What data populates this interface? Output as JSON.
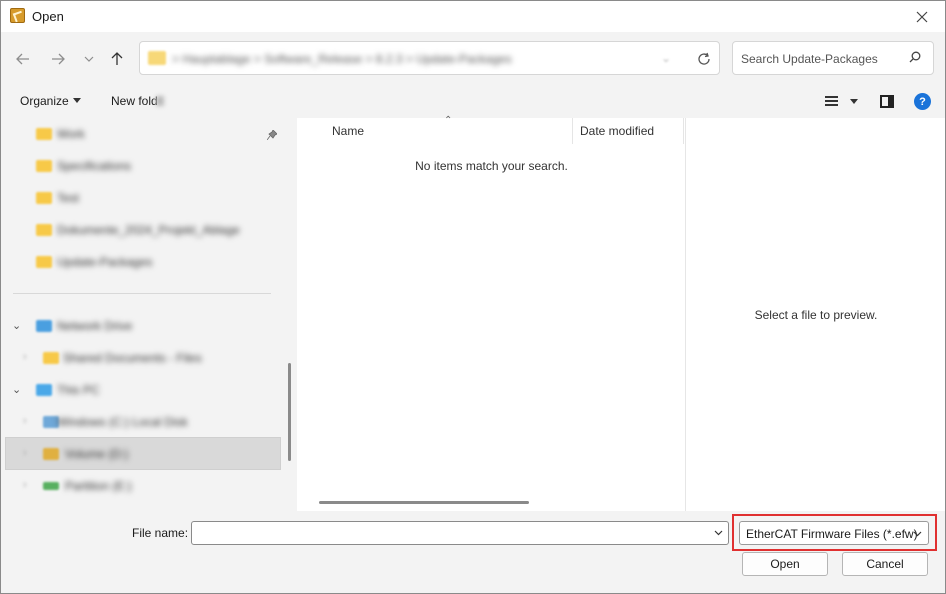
{
  "window": {
    "title": "Open"
  },
  "address": {
    "path_blurred": "> Hauptablage > Software_Release > 8.2.3 > Update-Packages",
    "search_placeholder": "Search Update-Packages"
  },
  "toolbar": {
    "organize_label": "Organize",
    "new_folder_label": "New fold"
  },
  "navigation": {
    "items": [
      {
        "label": "Work",
        "color": "#f7c948"
      },
      {
        "label": "Specifications",
        "color": "#f7c948"
      },
      {
        "label": "Test",
        "color": "#f7c948"
      },
      {
        "label": "Dokumente_2024_Projekt_Ablage",
        "color": "#f7c948"
      },
      {
        "label": "Update-Packages",
        "color": "#f7c948"
      },
      {
        "label": "Network Drive",
        "color": "#4a9fe0"
      },
      {
        "label": "Shared Documents - Files",
        "color": "#f7c948"
      },
      {
        "label": "This PC",
        "color": "#4aa8e8"
      },
      {
        "label": "Windows (C:) Local Disk",
        "color": "#6fa8d8"
      },
      {
        "label": "Volume (D:)",
        "color": "#e0b040"
      },
      {
        "label": "Partition (E:)",
        "color": "#58b060"
      }
    ]
  },
  "file_list": {
    "columns": [
      "Name",
      "Date modified"
    ],
    "empty_message": "No items match your search."
  },
  "preview": {
    "message": "Select a file to preview."
  },
  "bottom": {
    "file_name_label": "File name:",
    "file_name_value": "",
    "file_type_filter": "EtherCAT Firmware Files (*.efw)",
    "open_label": "Open",
    "cancel_label": "Cancel"
  },
  "colors": {
    "accent": "#1a73d9",
    "highlight": "#e03030"
  }
}
